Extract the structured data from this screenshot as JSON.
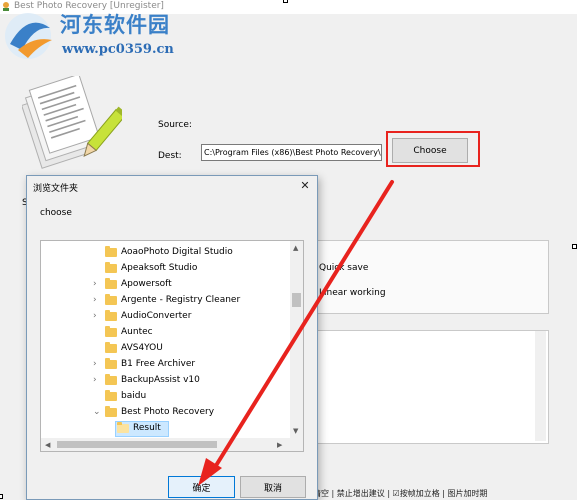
{
  "window": {
    "title": "Best Photo Recovery [Unregister]"
  },
  "watermark": {
    "name": "河东软件园",
    "url": "www.pc0359.cn"
  },
  "form": {
    "source_label": "Source:",
    "dest_label": "Dest:",
    "dest_value": "C:\\Program Files (x86)\\Best Photo Recovery\\Res",
    "choose_label": "Choose",
    "stray_label": "S"
  },
  "options": {
    "quick_save": "Quick save",
    "linear_working": "Linear working"
  },
  "bottom_strip": {
    "text": "计清空  | 禁止增出建议 | ☑按帧加立格 | 图片加时期"
  },
  "dialog": {
    "title": "浏览文件夹",
    "close_glyph": "✕",
    "description": "choose",
    "tree": [
      {
        "label": "AoaoPhoto Digital Studio",
        "expander": "none",
        "indent": 0
      },
      {
        "label": "Apeaksoft Studio",
        "expander": "none",
        "indent": 0
      },
      {
        "label": "Apowersoft",
        "expander": "collapsed",
        "indent": 0
      },
      {
        "label": "Argente - Registry Cleaner",
        "expander": "collapsed",
        "indent": 0
      },
      {
        "label": "AudioConverter",
        "expander": "collapsed",
        "indent": 0
      },
      {
        "label": "Auntec",
        "expander": "none",
        "indent": 0
      },
      {
        "label": "AVS4YOU",
        "expander": "none",
        "indent": 0
      },
      {
        "label": "B1 Free Archiver",
        "expander": "collapsed",
        "indent": 0
      },
      {
        "label": "BackupAssist v10",
        "expander": "collapsed",
        "indent": 0
      },
      {
        "label": "baidu",
        "expander": "none",
        "indent": 0
      },
      {
        "label": "Best Photo Recovery",
        "expander": "expanded",
        "indent": 0
      },
      {
        "label": "Result",
        "expander": "none",
        "indent": 1,
        "selected": true
      }
    ],
    "ok_label": "确定",
    "cancel_label": "取消"
  },
  "colors": {
    "highlight": "#e8231e",
    "folder": "#f4c654",
    "selection": "#cce8ff",
    "watermark_blue": "#3a80c8"
  }
}
